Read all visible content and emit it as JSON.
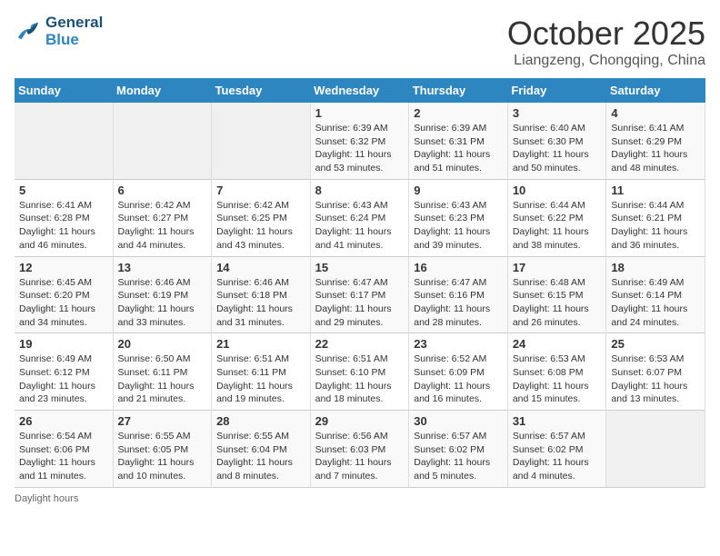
{
  "logo": {
    "line1": "General",
    "line2": "Blue"
  },
  "title": "October 2025",
  "location": "Liangzeng, Chongqing, China",
  "days_of_week": [
    "Sunday",
    "Monday",
    "Tuesday",
    "Wednesday",
    "Thursday",
    "Friday",
    "Saturday"
  ],
  "weeks": [
    [
      {
        "num": "",
        "info": ""
      },
      {
        "num": "",
        "info": ""
      },
      {
        "num": "",
        "info": ""
      },
      {
        "num": "1",
        "info": "Sunrise: 6:39 AM\nSunset: 6:32 PM\nDaylight: 11 hours\nand 53 minutes."
      },
      {
        "num": "2",
        "info": "Sunrise: 6:39 AM\nSunset: 6:31 PM\nDaylight: 11 hours\nand 51 minutes."
      },
      {
        "num": "3",
        "info": "Sunrise: 6:40 AM\nSunset: 6:30 PM\nDaylight: 11 hours\nand 50 minutes."
      },
      {
        "num": "4",
        "info": "Sunrise: 6:41 AM\nSunset: 6:29 PM\nDaylight: 11 hours\nand 48 minutes."
      }
    ],
    [
      {
        "num": "5",
        "info": "Sunrise: 6:41 AM\nSunset: 6:28 PM\nDaylight: 11 hours\nand 46 minutes."
      },
      {
        "num": "6",
        "info": "Sunrise: 6:42 AM\nSunset: 6:27 PM\nDaylight: 11 hours\nand 44 minutes."
      },
      {
        "num": "7",
        "info": "Sunrise: 6:42 AM\nSunset: 6:25 PM\nDaylight: 11 hours\nand 43 minutes."
      },
      {
        "num": "8",
        "info": "Sunrise: 6:43 AM\nSunset: 6:24 PM\nDaylight: 11 hours\nand 41 minutes."
      },
      {
        "num": "9",
        "info": "Sunrise: 6:43 AM\nSunset: 6:23 PM\nDaylight: 11 hours\nand 39 minutes."
      },
      {
        "num": "10",
        "info": "Sunrise: 6:44 AM\nSunset: 6:22 PM\nDaylight: 11 hours\nand 38 minutes."
      },
      {
        "num": "11",
        "info": "Sunrise: 6:44 AM\nSunset: 6:21 PM\nDaylight: 11 hours\nand 36 minutes."
      }
    ],
    [
      {
        "num": "12",
        "info": "Sunrise: 6:45 AM\nSunset: 6:20 PM\nDaylight: 11 hours\nand 34 minutes."
      },
      {
        "num": "13",
        "info": "Sunrise: 6:46 AM\nSunset: 6:19 PM\nDaylight: 11 hours\nand 33 minutes."
      },
      {
        "num": "14",
        "info": "Sunrise: 6:46 AM\nSunset: 6:18 PM\nDaylight: 11 hours\nand 31 minutes."
      },
      {
        "num": "15",
        "info": "Sunrise: 6:47 AM\nSunset: 6:17 PM\nDaylight: 11 hours\nand 29 minutes."
      },
      {
        "num": "16",
        "info": "Sunrise: 6:47 AM\nSunset: 6:16 PM\nDaylight: 11 hours\nand 28 minutes."
      },
      {
        "num": "17",
        "info": "Sunrise: 6:48 AM\nSunset: 6:15 PM\nDaylight: 11 hours\nand 26 minutes."
      },
      {
        "num": "18",
        "info": "Sunrise: 6:49 AM\nSunset: 6:14 PM\nDaylight: 11 hours\nand 24 minutes."
      }
    ],
    [
      {
        "num": "19",
        "info": "Sunrise: 6:49 AM\nSunset: 6:12 PM\nDaylight: 11 hours\nand 23 minutes."
      },
      {
        "num": "20",
        "info": "Sunrise: 6:50 AM\nSunset: 6:11 PM\nDaylight: 11 hours\nand 21 minutes."
      },
      {
        "num": "21",
        "info": "Sunrise: 6:51 AM\nSunset: 6:11 PM\nDaylight: 11 hours\nand 19 minutes."
      },
      {
        "num": "22",
        "info": "Sunrise: 6:51 AM\nSunset: 6:10 PM\nDaylight: 11 hours\nand 18 minutes."
      },
      {
        "num": "23",
        "info": "Sunrise: 6:52 AM\nSunset: 6:09 PM\nDaylight: 11 hours\nand 16 minutes."
      },
      {
        "num": "24",
        "info": "Sunrise: 6:53 AM\nSunset: 6:08 PM\nDaylight: 11 hours\nand 15 minutes."
      },
      {
        "num": "25",
        "info": "Sunrise: 6:53 AM\nSunset: 6:07 PM\nDaylight: 11 hours\nand 13 minutes."
      }
    ],
    [
      {
        "num": "26",
        "info": "Sunrise: 6:54 AM\nSunset: 6:06 PM\nDaylight: 11 hours\nand 11 minutes."
      },
      {
        "num": "27",
        "info": "Sunrise: 6:55 AM\nSunset: 6:05 PM\nDaylight: 11 hours\nand 10 minutes."
      },
      {
        "num": "28",
        "info": "Sunrise: 6:55 AM\nSunset: 6:04 PM\nDaylight: 11 hours\nand 8 minutes."
      },
      {
        "num": "29",
        "info": "Sunrise: 6:56 AM\nSunset: 6:03 PM\nDaylight: 11 hours\nand 7 minutes."
      },
      {
        "num": "30",
        "info": "Sunrise: 6:57 AM\nSunset: 6:02 PM\nDaylight: 11 hours\nand 5 minutes."
      },
      {
        "num": "31",
        "info": "Sunrise: 6:57 AM\nSunset: 6:02 PM\nDaylight: 11 hours\nand 4 minutes."
      },
      {
        "num": "",
        "info": ""
      }
    ]
  ],
  "footer": {
    "daylight_label": "Daylight hours"
  }
}
